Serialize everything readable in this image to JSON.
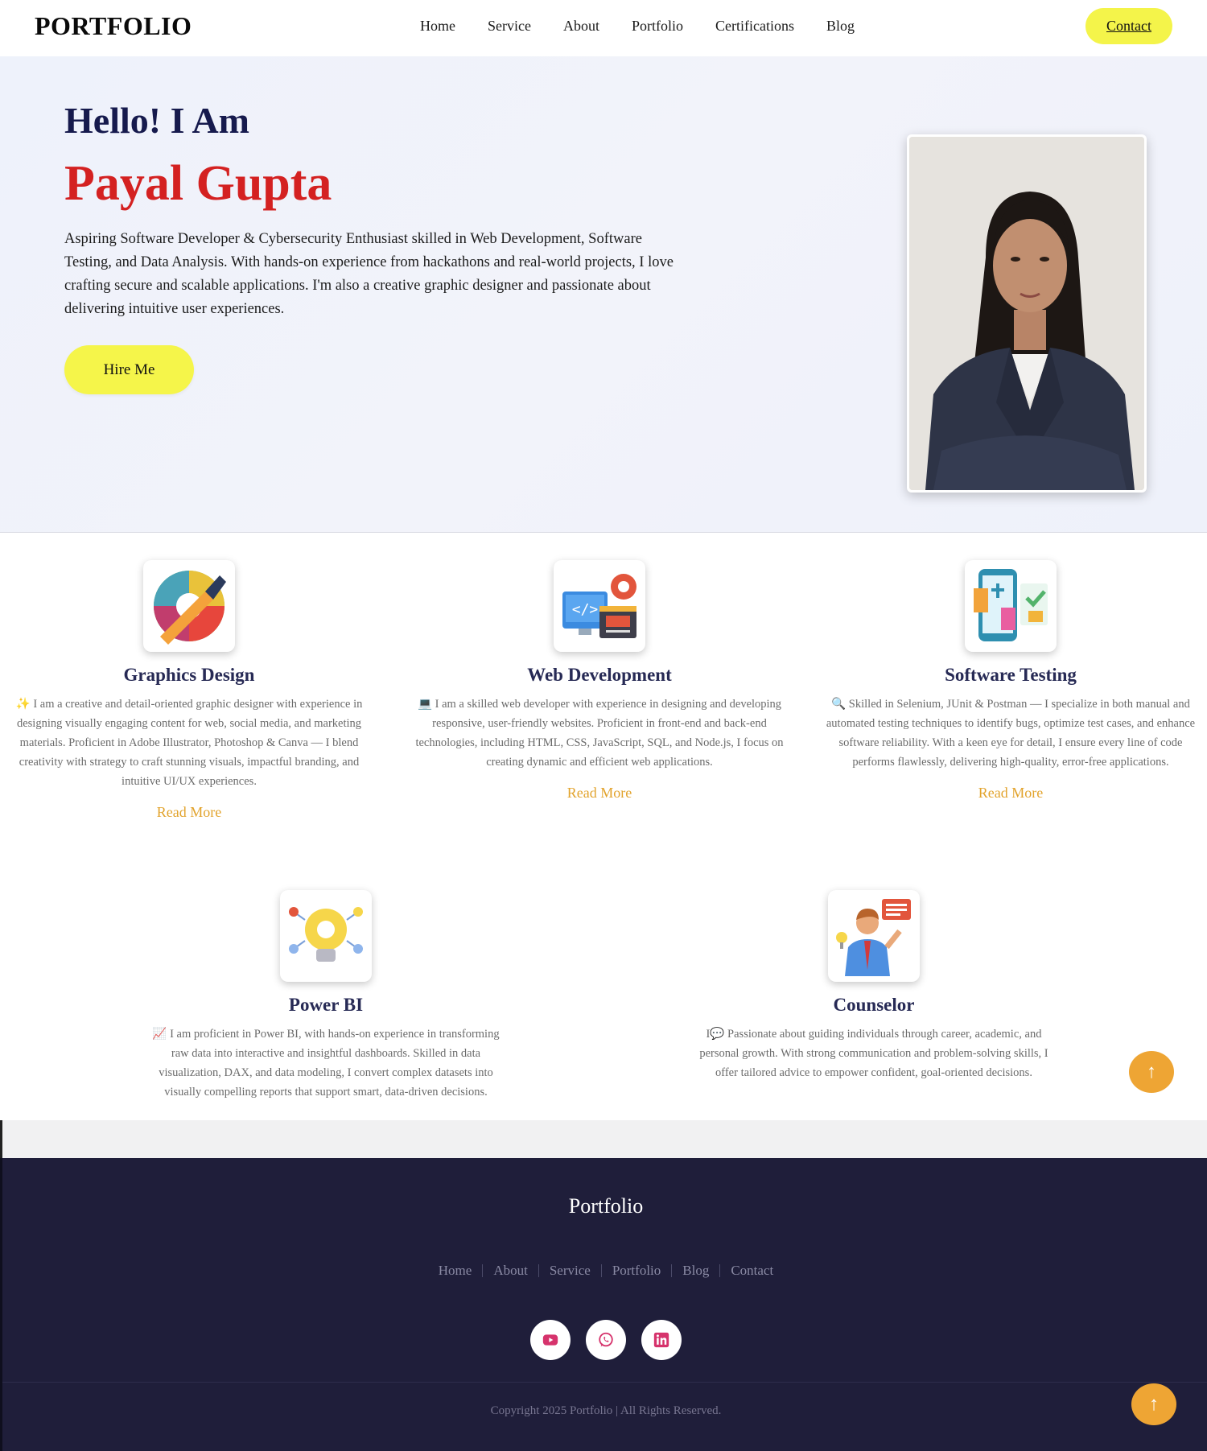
{
  "nav": {
    "brand": "PORTFOLIO",
    "links": [
      "Home",
      "Service",
      "About",
      "Portfolio",
      "Certifications",
      "Blog"
    ],
    "contact_label": "Contact"
  },
  "hero": {
    "greeting": "Hello! I Am",
    "name": "Payal Gupta",
    "bio": "Aspiring Software Developer & Cybersecurity Enthusiast skilled in Web Development, Software Testing, and Data Analysis. With hands-on experience from hackathons and real-world projects, I love crafting secure and scalable applications. I'm also a creative graphic designer and passionate about delivering intuitive user experiences.",
    "hire_label": "Hire Me"
  },
  "services": [
    {
      "title": "Graphics Design",
      "emoji": "✨",
      "description": "I am a creative and detail-oriented graphic designer with experience in designing visually engaging content for web, social media, and marketing materials. Proficient in Adobe Illustrator, Photoshop & Canva — I blend creativity with strategy to craft stunning visuals, impactful branding, and intuitive UI/UX experiences.",
      "read_more": "Read More"
    },
    {
      "title": "Web Development",
      "emoji": "💻",
      "description": "I am a skilled web developer with experience in designing and developing responsive, user-friendly websites. Proficient in front-end and back-end technologies, including HTML, CSS, JavaScript, SQL, and Node.js, I focus on creating dynamic and efficient web applications.",
      "read_more": "Read More"
    },
    {
      "title": "Software Testing",
      "emoji": "🔍",
      "description": "Skilled in Selenium, JUnit & Postman — I specialize in both manual and automated testing techniques to identify bugs, optimize test cases, and enhance software reliability. With a keen eye for detail, I ensure every line of code performs flawlessly, delivering high-quality, error-free applications.",
      "read_more": "Read More"
    },
    {
      "title": "Power BI",
      "emoji": "📈",
      "description": "I am proficient in Power BI, with hands-on experience in transforming raw data into interactive and insightful dashboards. Skilled in data visualization, DAX, and data modeling, I convert complex datasets into visually compelling reports that support smart, data-driven decisions."
    },
    {
      "title": "Counselor",
      "emoji": "I💬",
      "description": "Passionate about guiding individuals through career, academic, and personal growth. With strong communication and problem-solving skills, I offer tailored advice to empower confident, goal-oriented decisions."
    }
  ],
  "footer": {
    "title": "Portfolio",
    "links": [
      "Home",
      "About",
      "Service",
      "Portfolio",
      "Blog",
      "Contact"
    ],
    "socials": [
      "youtube-icon",
      "whatsapp-icon",
      "linkedin-icon"
    ],
    "copyright": "Copyright 2025 Portfolio | All Rights Reserved."
  },
  "colors": {
    "accent_yellow": "#f4f44a",
    "name_red": "#d42121",
    "read_more_orange": "#e2a32c",
    "footer_bg": "#1f1e3a",
    "social_icon_pink": "#d6336c",
    "scroll_top_orange": "#eea534"
  }
}
